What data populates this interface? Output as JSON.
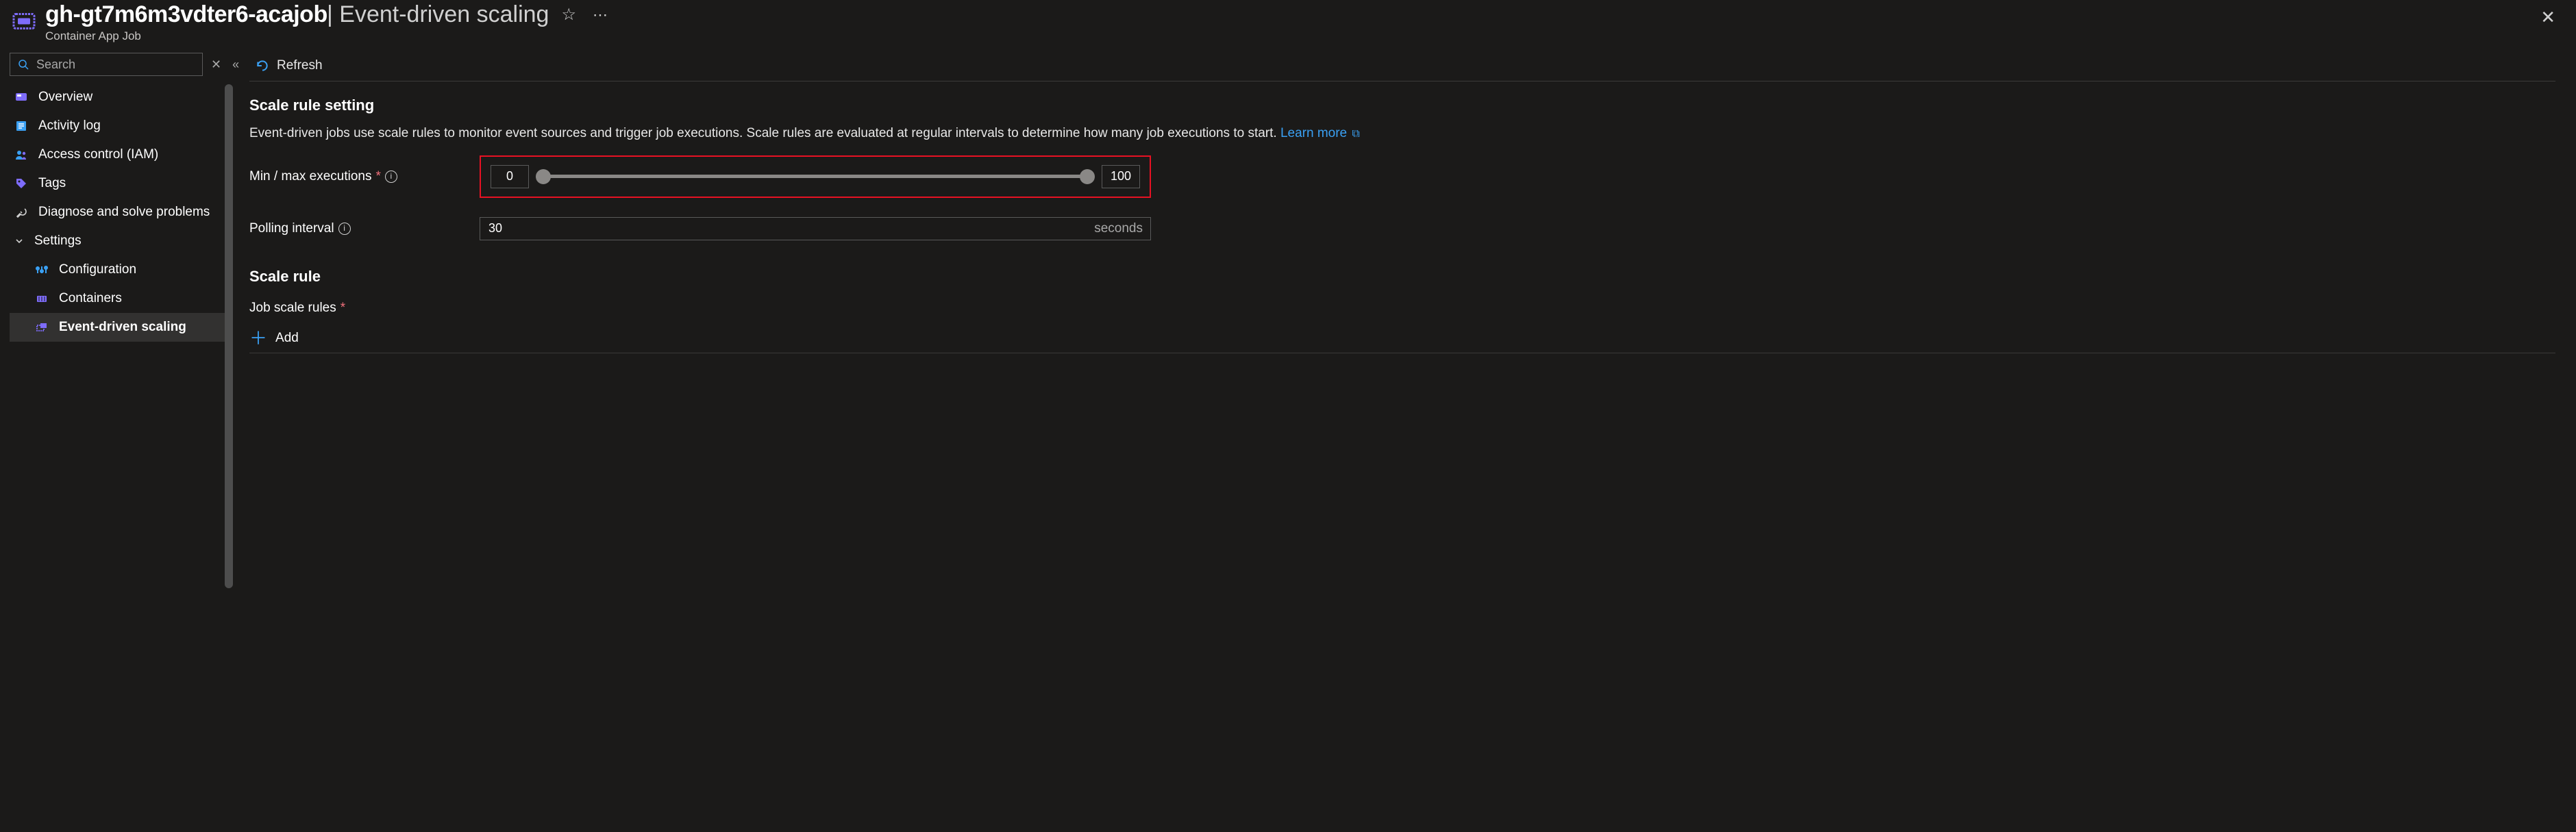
{
  "header": {
    "title": "gh-gt7m6m3vdter6-acajob",
    "suffix": " | Event-driven scaling",
    "subtitle": "Container App Job"
  },
  "search": {
    "placeholder": "Search"
  },
  "sidebar": {
    "items": [
      {
        "label": "Overview"
      },
      {
        "label": "Activity log"
      },
      {
        "label": "Access control (IAM)"
      },
      {
        "label": "Tags"
      },
      {
        "label": "Diagnose and solve problems"
      },
      {
        "label": "Settings"
      },
      {
        "label": "Configuration"
      },
      {
        "label": "Containers"
      },
      {
        "label": "Event-driven scaling"
      }
    ]
  },
  "cmdbar": {
    "refresh": "Refresh"
  },
  "scale_setting": {
    "heading": "Scale rule setting",
    "description": "Event-driven jobs use scale rules to monitor event sources and trigger job executions. Scale rules are evaluated at regular intervals to determine how many job executions to start. ",
    "learn_more": "Learn more",
    "minmax_label": "Min / max executions",
    "min_value": "0",
    "max_value": "100",
    "polling_label": "Polling interval",
    "polling_value": "30",
    "polling_suffix": "seconds"
  },
  "scale_rule": {
    "heading": "Scale rule",
    "job_rules_label": "Job scale rules",
    "add_label": "Add"
  }
}
